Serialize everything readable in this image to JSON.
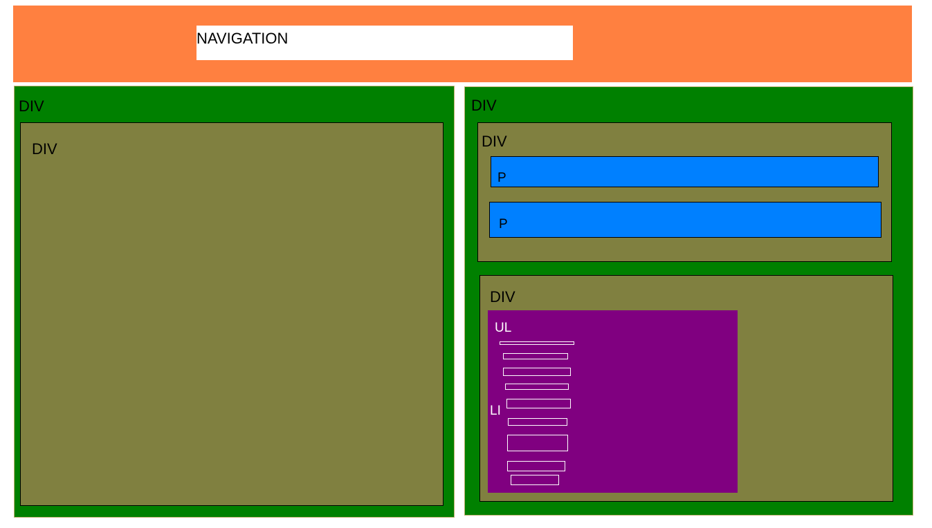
{
  "navigation": {
    "label": "NAVIGATION"
  },
  "left_column": {
    "label": "DIV",
    "inner": {
      "label": "DIV"
    }
  },
  "right_column": {
    "label": "DIV",
    "top_div": {
      "label": "DIV",
      "paragraphs": [
        {
          "label": "P"
        },
        {
          "label": "P"
        }
      ]
    },
    "bottom_div": {
      "label": "DIV",
      "list": {
        "label": "UL",
        "item_label": "LI",
        "item_count": 9
      }
    }
  },
  "colors": {
    "navigation": "#ff8040",
    "container": "#008000",
    "div": "#808040",
    "paragraph": "#0080ff",
    "list": "#800080"
  }
}
